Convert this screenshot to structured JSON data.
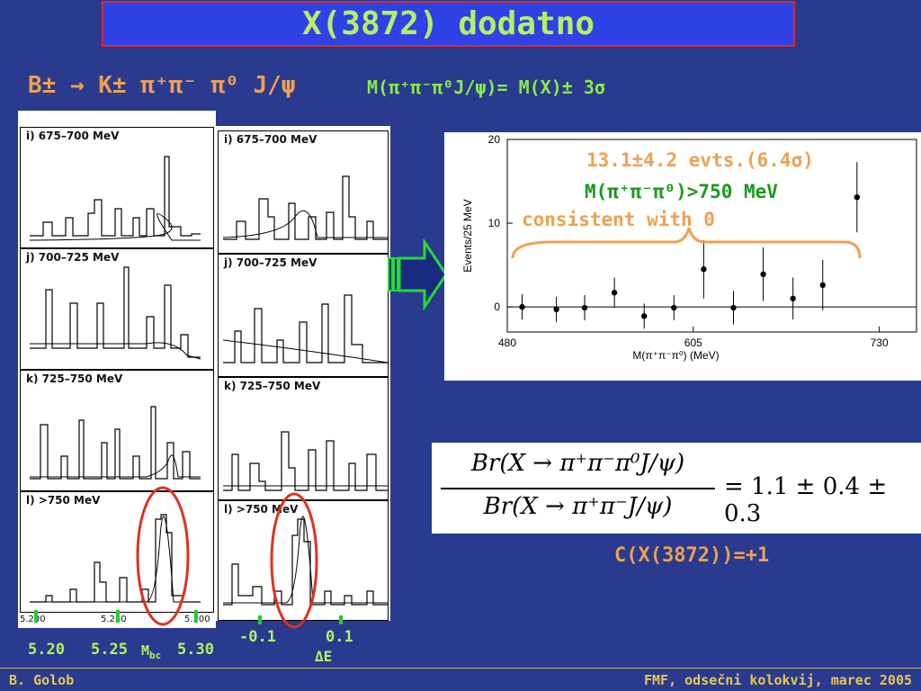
{
  "slide": {
    "title": "X(3872) dodatno",
    "decay": "B± → K± π⁺π⁻ π⁰ J/ψ",
    "mass_condition": "M(π⁺π⁻π⁰J/ψ)= M(X)± 3σ",
    "c_parity": "C(X(3872))=+1",
    "footer_left": "B. Golob",
    "footer_right": "FMF, odsečni kolokvij, marec 2005"
  },
  "left_panels": {
    "labels": [
      "i) 675–700 MeV",
      "j) 700–725 MeV",
      "k) 725–750 MeV",
      "l) >750 MeV"
    ],
    "x_ticks": [
      "5.200",
      "5.250",
      "5.300"
    ],
    "axis_values": [
      "5.20",
      "5.25",
      "5.30"
    ],
    "axis_label": "M",
    "axis_label_sub": "bc"
  },
  "right_panels": {
    "labels": [
      "i) 675–700 MeV",
      "j) 700–725 MeV",
      "k) 725–750 MeV",
      "l) >750 MeV"
    ],
    "axis_values": [
      "-0.1",
      "0.1"
    ],
    "axis_label": "ΔE"
  },
  "chart_data": {
    "type": "scatter",
    "x": [
      490,
      513,
      532,
      552,
      572,
      592,
      612,
      632,
      652,
      672,
      692,
      715
    ],
    "y": [
      0,
      -0.3,
      -0.1,
      1.7,
      -1.1,
      -0.1,
      4.5,
      -0.1,
      3.9,
      1.0,
      2.6,
      13.1
    ],
    "yerr": [
      1.5,
      1.5,
      1.5,
      1.8,
      1.5,
      1.5,
      3.5,
      2.0,
      3.2,
      2.5,
      3.0,
      4.2
    ],
    "xlim": [
      480,
      755
    ],
    "ylim": [
      -3,
      20
    ],
    "xticks": [
      "480",
      "605",
      "730"
    ],
    "yticks": [
      "0",
      "10",
      "20"
    ],
    "xlabel": "M(π⁺π⁻π⁰) (MeV)",
    "ylabel": "Events/25 MeV",
    "annotations": [
      {
        "text": "13.1±4.2 evts.(6.4σ)",
        "color": "#f0a050"
      },
      {
        "text": "M(π⁺π⁻π⁰)>750 MeV",
        "color": "#1a9a1a"
      },
      {
        "text": "consistent with 0",
        "color": "#f0a050"
      }
    ]
  },
  "ratio": {
    "numerator": "Br(X → π⁺π⁻π⁰J/ψ)",
    "denominator": "Br(X → π⁺π⁻J/ψ)",
    "result": "= 1.1 ± 0.4 ± 0.3"
  },
  "colors": {
    "background": "#2a3a8e",
    "title_fill": "#2e42e6",
    "title_text": "#b8f060",
    "orange": "#f0a050",
    "green": "#88ee44",
    "ellipse": "#e03020"
  }
}
